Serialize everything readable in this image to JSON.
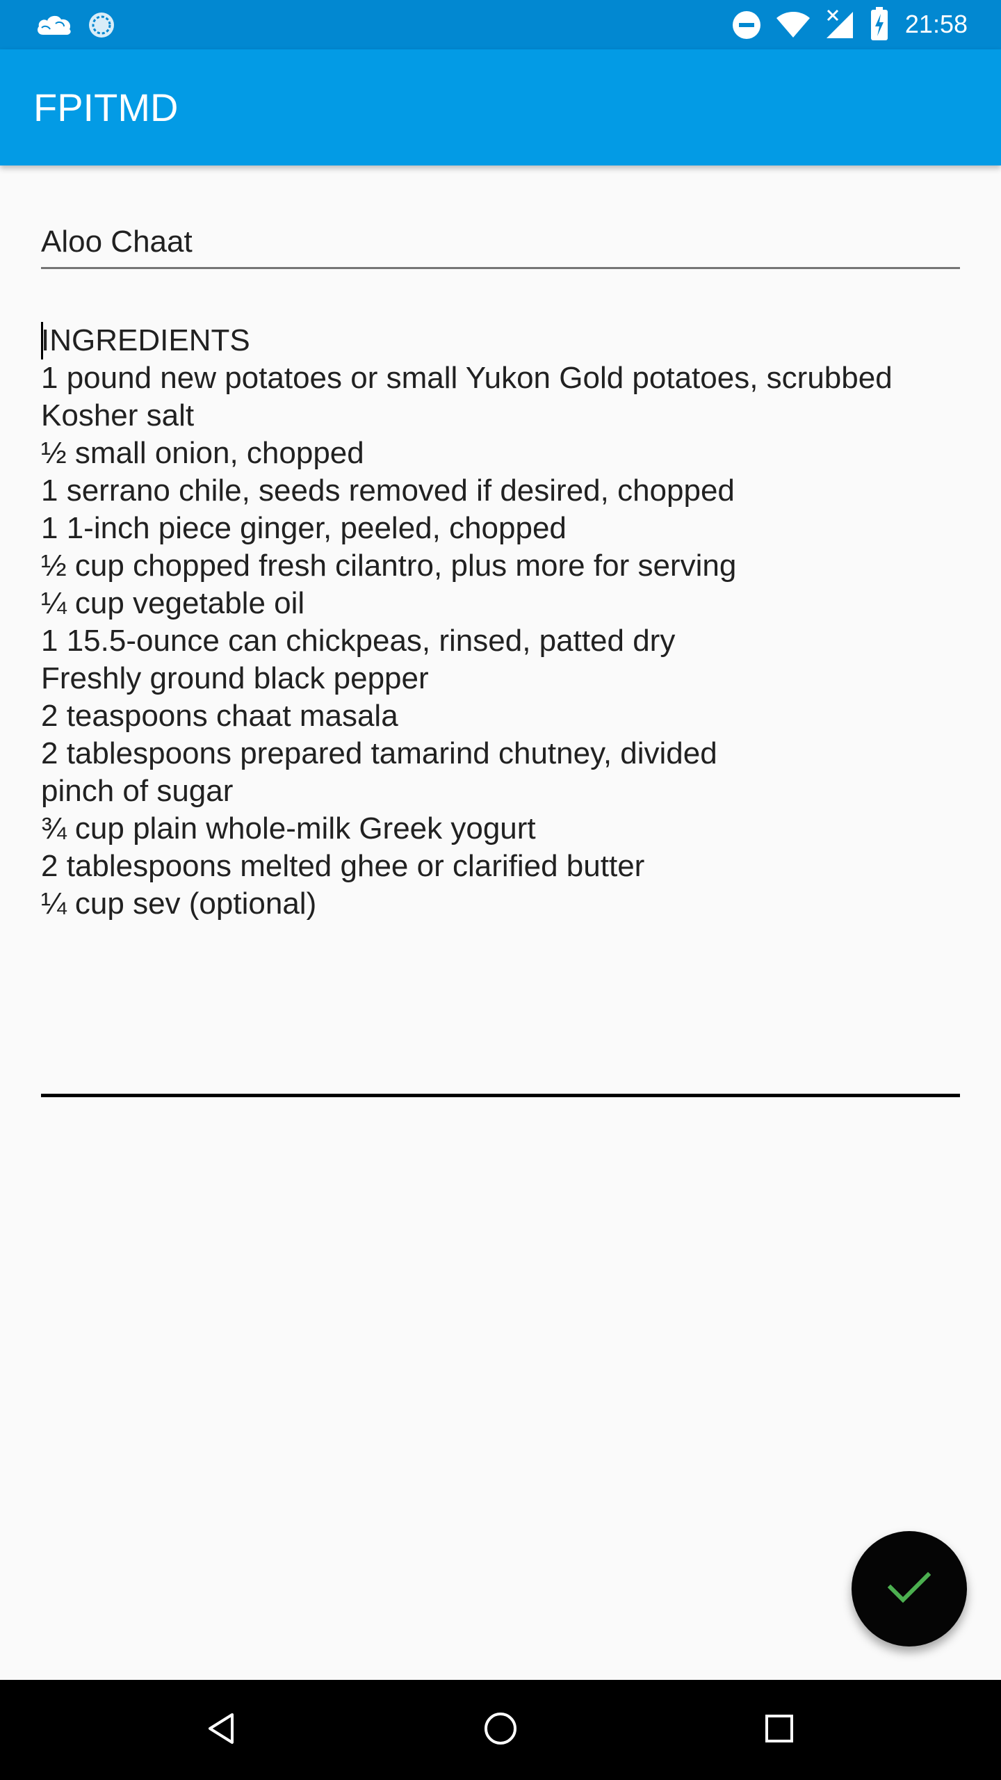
{
  "status_bar": {
    "time": "21:58",
    "left_icons": [
      "cloud-icon",
      "sync-icon"
    ],
    "right_icons": [
      "do-not-disturb-icon",
      "wifi-icon",
      "signal-icon",
      "battery-charging-icon"
    ]
  },
  "app_bar": {
    "title": "FPITMD"
  },
  "editor": {
    "title_value": "Aloo Chaat",
    "body_lines": [
      "INGREDIENTS",
      "1 pound new potatoes or small Yukon Gold potatoes, scrubbed",
      "Kosher salt",
      "½ small onion, chopped",
      "1 serrano chile, seeds removed if desired, chopped",
      "1 1-inch piece ginger, peeled, chopped",
      "½ cup chopped fresh cilantro, plus more for serving",
      "¼ cup vegetable oil",
      "1 15.5-ounce can chickpeas, rinsed, patted dry",
      "Freshly ground black pepper",
      "2 teaspoons chaat masala",
      "2 tablespoons prepared tamarind chutney, divided",
      "pinch of sugar",
      "¾ cup plain whole-milk Greek yogurt",
      "2 tablespoons melted ghee or clarified butter",
      "¼ cup sev (optional)"
    ]
  },
  "fab": {
    "icon": "check-icon",
    "icon_color": "#4caf50"
  },
  "nav_bar": {
    "buttons": [
      "back-icon",
      "home-icon",
      "recents-icon"
    ]
  },
  "colors": {
    "status_bar": "#0288d1",
    "app_bar": "#039be5",
    "background": "#fafafa",
    "fab": "#050505"
  }
}
